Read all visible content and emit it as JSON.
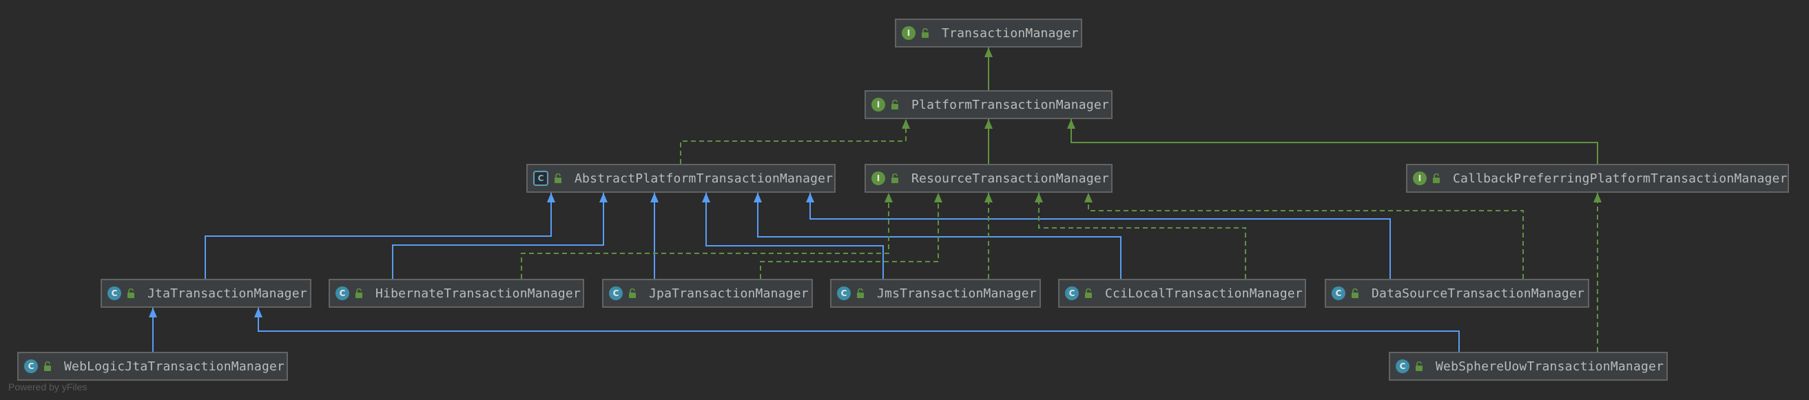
{
  "colors": {
    "background": "#2b2b2b",
    "node_fill": "#3c3f41",
    "node_border": "#636363",
    "extends_edge": "#589df6",
    "implements_edge": "#5f9340",
    "text": "#bbbbbb"
  },
  "diagram": {
    "nodes": [
      {
        "id": "TransactionManager",
        "kind": "interface",
        "icon": "interface-icon",
        "label": "TransactionManager"
      },
      {
        "id": "PlatformTransactionManager",
        "kind": "interface",
        "icon": "interface-icon",
        "label": "PlatformTransactionManager"
      },
      {
        "id": "AbstractPlatformTransactionManager",
        "kind": "abstract-class",
        "icon": "abstract-class-icon",
        "label": "AbstractPlatformTransactionManager"
      },
      {
        "id": "ResourceTransactionManager",
        "kind": "interface",
        "icon": "interface-icon",
        "label": "ResourceTransactionManager"
      },
      {
        "id": "CallbackPreferringPlatformTransactionManager",
        "kind": "interface",
        "icon": "interface-icon",
        "label": "CallbackPreferringPlatformTransactionManager"
      },
      {
        "id": "JtaTransactionManager",
        "kind": "class",
        "icon": "class-icon",
        "label": "JtaTransactionManager"
      },
      {
        "id": "HibernateTransactionManager",
        "kind": "class",
        "icon": "class-icon",
        "label": "HibernateTransactionManager"
      },
      {
        "id": "JpaTransactionManager",
        "kind": "class",
        "icon": "class-icon",
        "label": "JpaTransactionManager"
      },
      {
        "id": "JmsTransactionManager",
        "kind": "class",
        "icon": "class-icon",
        "label": "JmsTransactionManager"
      },
      {
        "id": "CciLocalTransactionManager",
        "kind": "class",
        "icon": "class-icon",
        "label": "CciLocalTransactionManager"
      },
      {
        "id": "DataSourceTransactionManager",
        "kind": "class",
        "icon": "class-icon",
        "label": "DataSourceTransactionManager"
      },
      {
        "id": "WebLogicJtaTransactionManager",
        "kind": "class",
        "icon": "class-icon",
        "label": "WebLogicJtaTransactionManager"
      },
      {
        "id": "WebSphereUowTransactionManager",
        "kind": "class",
        "icon": "class-icon",
        "label": "WebSphereUowTransactionManager"
      }
    ],
    "edges": [
      {
        "from": "PlatformTransactionManager",
        "to": "TransactionManager",
        "type": "extends-interface"
      },
      {
        "from": "AbstractPlatformTransactionManager",
        "to": "PlatformTransactionManager",
        "type": "implements"
      },
      {
        "from": "ResourceTransactionManager",
        "to": "PlatformTransactionManager",
        "type": "extends-interface"
      },
      {
        "from": "CallbackPreferringPlatformTransactionManager",
        "to": "PlatformTransactionManager",
        "type": "extends-interface"
      },
      {
        "from": "JtaTransactionManager",
        "to": "AbstractPlatformTransactionManager",
        "type": "extends"
      },
      {
        "from": "HibernateTransactionManager",
        "to": "AbstractPlatformTransactionManager",
        "type": "extends"
      },
      {
        "from": "JpaTransactionManager",
        "to": "AbstractPlatformTransactionManager",
        "type": "extends"
      },
      {
        "from": "JmsTransactionManager",
        "to": "AbstractPlatformTransactionManager",
        "type": "extends"
      },
      {
        "from": "CciLocalTransactionManager",
        "to": "AbstractPlatformTransactionManager",
        "type": "extends"
      },
      {
        "from": "DataSourceTransactionManager",
        "to": "AbstractPlatformTransactionManager",
        "type": "extends"
      },
      {
        "from": "HibernateTransactionManager",
        "to": "ResourceTransactionManager",
        "type": "implements"
      },
      {
        "from": "JpaTransactionManager",
        "to": "ResourceTransactionManager",
        "type": "implements"
      },
      {
        "from": "JmsTransactionManager",
        "to": "ResourceTransactionManager",
        "type": "implements"
      },
      {
        "from": "CciLocalTransactionManager",
        "to": "ResourceTransactionManager",
        "type": "implements"
      },
      {
        "from": "DataSourceTransactionManager",
        "to": "ResourceTransactionManager",
        "type": "implements"
      },
      {
        "from": "WebLogicJtaTransactionManager",
        "to": "JtaTransactionManager",
        "type": "extends"
      },
      {
        "from": "WebSphereUowTransactionManager",
        "to": "JtaTransactionManager",
        "type": "extends"
      },
      {
        "from": "WebSphereUowTransactionManager",
        "to": "CallbackPreferringPlatformTransactionManager",
        "type": "implements"
      }
    ]
  },
  "footer": {
    "text": "Powered by yFiles"
  }
}
